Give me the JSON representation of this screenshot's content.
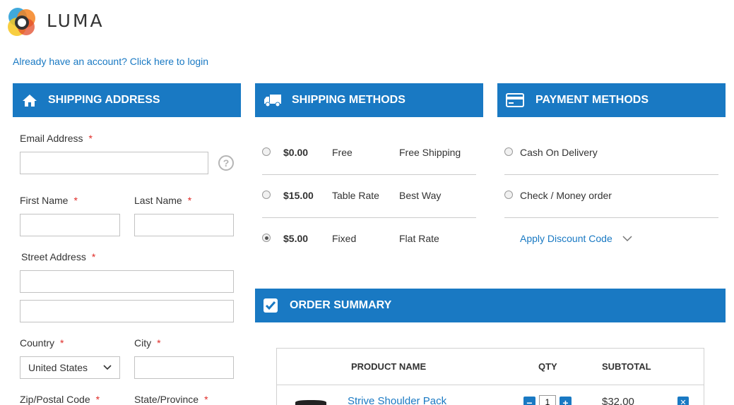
{
  "brand": {
    "name": "LUMA"
  },
  "account": {
    "login_prompt": "Already have an account? Click here to login"
  },
  "shipping_address": {
    "title": "SHIPPING ADDRESS",
    "icon": "home-icon",
    "email": {
      "label": "Email Address",
      "value": "",
      "required": "*"
    },
    "first_name": {
      "label": "First Name",
      "value": "",
      "required": "*"
    },
    "last_name": {
      "label": "Last Name",
      "value": "",
      "required": "*"
    },
    "street": {
      "label": "Street Address",
      "line1": "",
      "line2": "",
      "required": "*"
    },
    "country": {
      "label": "Country",
      "selected": "United States",
      "required": "*"
    },
    "city": {
      "label": "City",
      "value": "",
      "required": "*"
    },
    "zip": {
      "label": "Zip/Postal Code",
      "required": "*"
    },
    "state": {
      "label": "State/Province",
      "required": "*"
    },
    "help_icon_text": "?"
  },
  "shipping_methods": {
    "title": "SHIPPING METHODS",
    "icon": "truck-icon",
    "options": [
      {
        "price": "$0.00",
        "carrier": "Free",
        "method": "Free Shipping",
        "selected": false
      },
      {
        "price": "$15.00",
        "carrier": "Table Rate",
        "method": "Best Way",
        "selected": false
      },
      {
        "price": "$5.00",
        "carrier": "Fixed",
        "method": "Flat Rate",
        "selected": true
      }
    ]
  },
  "payment_methods": {
    "title": "PAYMENT METHODS",
    "icon": "credit-card-icon",
    "options": [
      {
        "label": "Cash On Delivery",
        "selected": false
      },
      {
        "label": "Check / Money order",
        "selected": false
      }
    ],
    "discount_label": "Apply Discount Code"
  },
  "order_summary": {
    "title": "ORDER SUMMARY",
    "icon": "checkbox-checked-icon",
    "columns": [
      "PRODUCT NAME",
      "QTY",
      "SUBTOTAL"
    ],
    "items": [
      {
        "name": "Strive Shoulder Pack",
        "qty": "1",
        "subtotal": "$32.00"
      }
    ],
    "qty_minus": "−",
    "qty_plus": "+",
    "remove": "✕"
  },
  "colors": {
    "accent": "#1979c3",
    "required": "#e02b27",
    "border": "#c2c2c2"
  }
}
